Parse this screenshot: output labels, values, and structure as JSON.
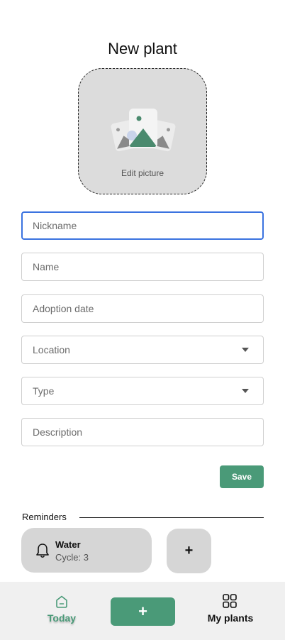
{
  "header": {
    "title": "New plant"
  },
  "picture": {
    "edit_label": "Edit picture",
    "icon": "image-gallery-icon"
  },
  "form": {
    "nickname": {
      "value": "",
      "placeholder": "Nickname"
    },
    "name": {
      "placeholder": "Name"
    },
    "adoption_date": {
      "placeholder": "Adoption date"
    },
    "location": {
      "placeholder": "Location"
    },
    "type": {
      "placeholder": "Type"
    },
    "description": {
      "placeholder": "Description"
    },
    "save_label": "Save"
  },
  "reminders": {
    "heading": "Reminders",
    "items": [
      {
        "title": "Water",
        "subtitle": "Cycle: 3",
        "icon": "bell-icon"
      }
    ],
    "add_label": "+"
  },
  "nav": {
    "today_label": "Today",
    "add_label": "+",
    "my_plants_label": "My plants"
  },
  "colors": {
    "accent": "#4a9a78",
    "focus_border": "#3b73e0",
    "card_bg": "#d6d6d6"
  }
}
